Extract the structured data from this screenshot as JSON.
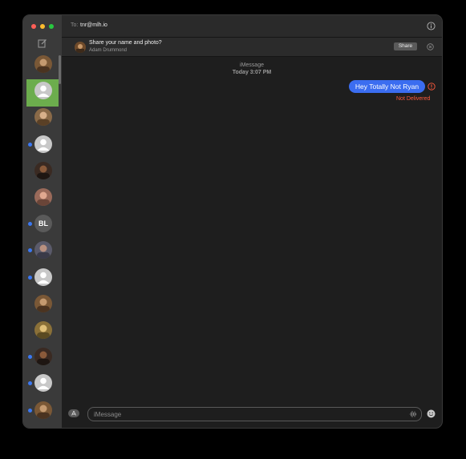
{
  "header": {
    "to_label": "To:",
    "recipient": "tnr@mlh.io"
  },
  "banner": {
    "title": "Share your name and photo?",
    "subtitle": "Adam Drummond",
    "share_label": "Share"
  },
  "thread": {
    "service": "iMessage",
    "time": "Today 3:07 PM",
    "messages": [
      {
        "text": "Hey Totally Not Ryan",
        "status": "Not Delivered"
      }
    ]
  },
  "sidebar": {
    "conversations": [
      {
        "avatar": "photo-brown",
        "unread": false,
        "selected": false
      },
      {
        "avatar": "default-person",
        "unread": false,
        "selected": true
      },
      {
        "avatar": "photo-tan",
        "unread": false,
        "selected": false
      },
      {
        "avatar": "default-person",
        "unread": true,
        "selected": false
      },
      {
        "avatar": "photo-dark",
        "unread": false,
        "selected": false
      },
      {
        "avatar": "photo-pink",
        "unread": false,
        "selected": false
      },
      {
        "avatar": "initials",
        "initials": "BL",
        "unread": true,
        "selected": false
      },
      {
        "avatar": "photo-group",
        "unread": true,
        "selected": false
      },
      {
        "avatar": "default-person",
        "unread": true,
        "selected": false
      },
      {
        "avatar": "photo-brown",
        "unread": false,
        "selected": false
      },
      {
        "avatar": "photo-gold",
        "unread": false,
        "selected": false
      },
      {
        "avatar": "photo-dark",
        "unread": true,
        "selected": false
      },
      {
        "avatar": "default-person",
        "unread": true,
        "selected": false
      },
      {
        "avatar": "photo-brown",
        "unread": true,
        "selected": false
      }
    ]
  },
  "composer": {
    "placeholder": "iMessage"
  },
  "colors": {
    "accent": "#3b6df0",
    "error": "#ff5a3c",
    "selected": "#6cad4d",
    "unread": "#3b78f3"
  }
}
